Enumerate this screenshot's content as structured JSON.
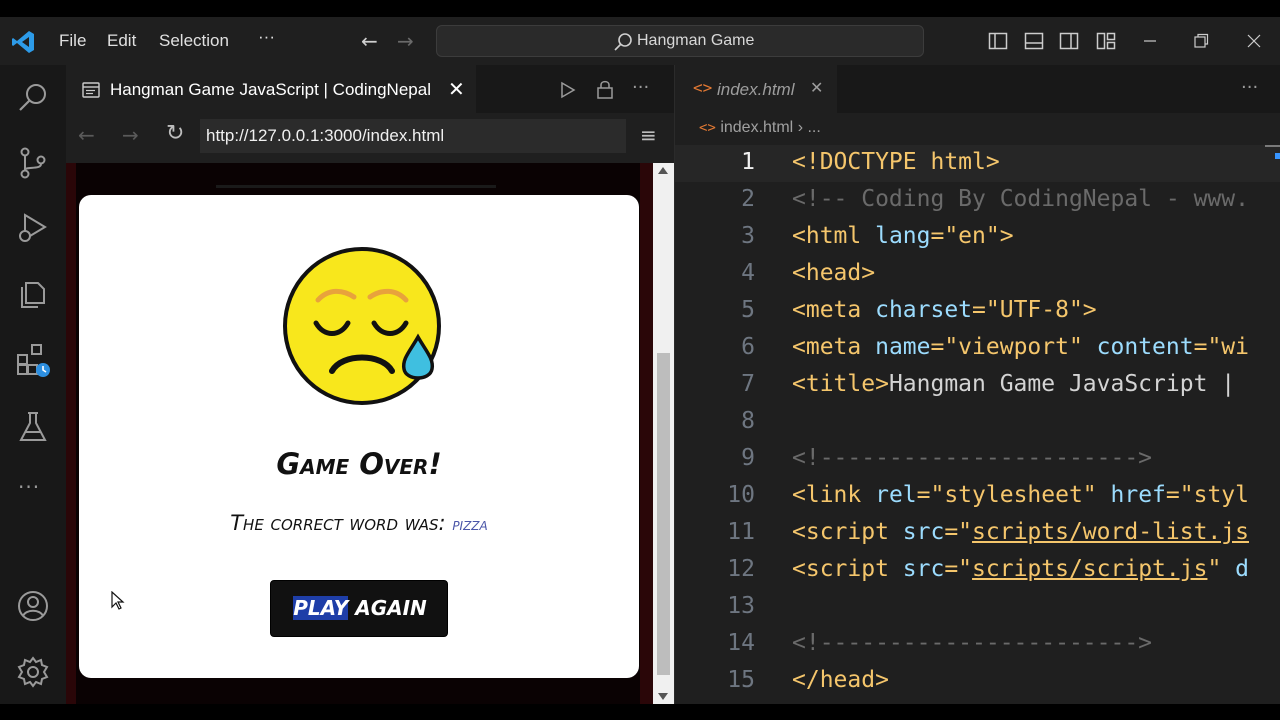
{
  "titlebar": {
    "menu": [
      "File",
      "Edit",
      "Selection",
      "···"
    ],
    "search": "Hangman Game"
  },
  "browser": {
    "tab_title": "Hangman Game JavaScript | CodingNepal",
    "url": "http://127.0.0.1:3000/index.html"
  },
  "game": {
    "title": "Game Over!",
    "message_prefix": "The correct word was: ",
    "word": "pizza",
    "button_selected": "PLAY",
    "button_rest": " AGAIN"
  },
  "editor": {
    "tab": "index.html",
    "breadcrumb_file": "index.html",
    "breadcrumb_more": "...",
    "current_line": 1,
    "lines": [
      {
        "n": "1",
        "html": "<span class='t-tag'>&lt;!DOCTYPE html&gt;</span>"
      },
      {
        "n": "2",
        "html": "<span class='t-com'>&lt;!-- Coding By CodingNepal - www.</span>"
      },
      {
        "n": "3",
        "html": "<span class='t-tag'>&lt;html </span><span class='t-att'>lang</span><span class='t-tag'>=\"en\"&gt;</span>"
      },
      {
        "n": "4",
        "html": "<span class='t-tag'>&lt;head&gt;</span>"
      },
      {
        "n": "5",
        "html": "<span class='t-tag'>&lt;meta </span><span class='t-att'>charset</span><span class='t-tag'>=\"UTF-8\"&gt;</span>"
      },
      {
        "n": "6",
        "html": "<span class='t-tag'>&lt;meta </span><span class='t-att'>name</span><span class='t-tag'>=\"viewport\" </span><span class='t-att'>content</span><span class='t-tag'>=\"wi</span>"
      },
      {
        "n": "7",
        "html": "<span class='t-tag'>&lt;title&gt;</span><span class='t-txt'>Hangman Game JavaScript |</span>"
      },
      {
        "n": "8",
        "html": ""
      },
      {
        "n": "9",
        "html": "<span class='t-com'>&lt;!-----------------------&gt;</span>"
      },
      {
        "n": "10",
        "html": "<span class='t-tag'>&lt;link </span><span class='t-att'>rel</span><span class='t-tag'>=\"stylesheet\" </span><span class='t-att'>href</span><span class='t-tag'>=\"styl</span>"
      },
      {
        "n": "11",
        "html": "<span class='t-tag'>&lt;script </span><span class='t-att'>src</span><span class='t-tag'>=\"<u>scripts/word-list.js</u></span>"
      },
      {
        "n": "12",
        "html": "<span class='t-tag'>&lt;script </span><span class='t-att'>src</span><span class='t-tag'>=\"<u>scripts/script.js</u>\" </span><span class='t-att'>d</span>"
      },
      {
        "n": "13",
        "html": ""
      },
      {
        "n": "14",
        "html": "<span class='t-com'>&lt;!-----------------------&gt;</span>"
      },
      {
        "n": "15",
        "html": "<span class='t-tag'>&lt;/head&gt;</span>"
      }
    ]
  }
}
